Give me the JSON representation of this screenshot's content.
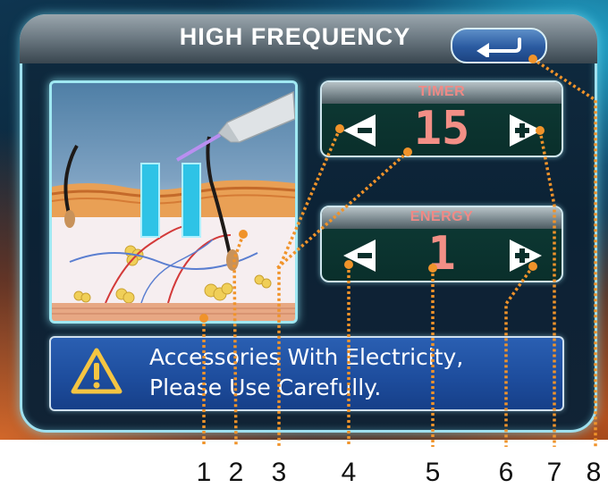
{
  "screen": {
    "title": "HIGH FREQUENCY",
    "back_button_icon": "return-arrow-icon"
  },
  "timer": {
    "label": "TIMER",
    "value": "15",
    "decrease_icon": "minus-arrow-icon",
    "increase_icon": "plus-arrow-icon"
  },
  "energy": {
    "label": "ENERGY",
    "value": "1",
    "decrease_icon": "minus-arrow-icon",
    "increase_icon": "plus-arrow-icon"
  },
  "warning": {
    "icon": "warning-triangle-icon",
    "line1": "Accessories With Electricity,",
    "line2": "Please Use Carefully."
  },
  "callouts": [
    "1",
    "2",
    "3",
    "4",
    "5",
    "6",
    "7",
    "8"
  ],
  "colors": {
    "accent_value": "#f38f86",
    "panel_border": "#9fe0ef",
    "callout_dots": "#f0932a",
    "warning_bg": "#1d4c9c"
  }
}
